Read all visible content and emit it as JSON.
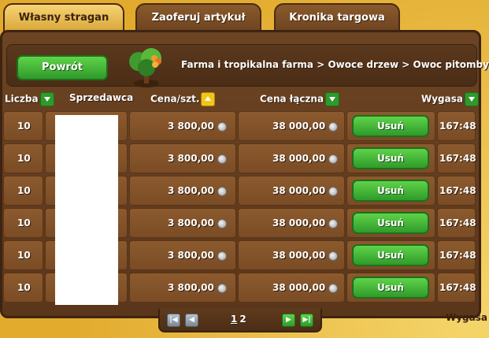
{
  "tabs": [
    {
      "label": "Własny stragan",
      "active": true
    },
    {
      "label": "Zaoferuj artykuł",
      "active": false
    },
    {
      "label": "Kronika targowa",
      "active": false
    }
  ],
  "back_button": "Powrót",
  "breadcrumb": "Farma i tropikalna farma > Owoce drzew > Owoc pitomby",
  "columns": {
    "count": "Liczba",
    "seller": "Sprzedawca",
    "unit_price": "Cena/szt.",
    "total_price": "Cena łączna",
    "expires": "Wygasa"
  },
  "rows": [
    {
      "count": "10",
      "unit_price": "3 800,00",
      "total": "38 000,00",
      "action": "Usuń",
      "expires": "167:48"
    },
    {
      "count": "10",
      "unit_price": "3 800,00",
      "total": "38 000,00",
      "action": "Usuń",
      "expires": "167:48"
    },
    {
      "count": "10",
      "unit_price": "3 800,00",
      "total": "38 000,00",
      "action": "Usuń",
      "expires": "167:48"
    },
    {
      "count": "10",
      "unit_price": "3 800,00",
      "total": "38 000,00",
      "action": "Usuń",
      "expires": "167:48"
    },
    {
      "count": "10",
      "unit_price": "3 800,00",
      "total": "38 000,00",
      "action": "Usuń",
      "expires": "167:48"
    },
    {
      "count": "10",
      "unit_price": "3 800,00",
      "total": "38 000,00",
      "action": "Usuń",
      "expires": "167:48"
    }
  ],
  "pager": {
    "pages": [
      "1",
      "2"
    ],
    "current": "1"
  },
  "icons": {
    "sort_down": "sort-down-icon",
    "sort_up": "sort-up-icon",
    "coin": "silver-coin-icon",
    "first": "first-page-icon",
    "prev": "prev-page-icon",
    "next": "next-page-icon",
    "last": "last-page-icon"
  },
  "colors": {
    "accent_green": "#2f9a2a",
    "sort_active": "#f2c51a",
    "wood": "#7a4c25"
  },
  "corner_hint": "Wygasa"
}
